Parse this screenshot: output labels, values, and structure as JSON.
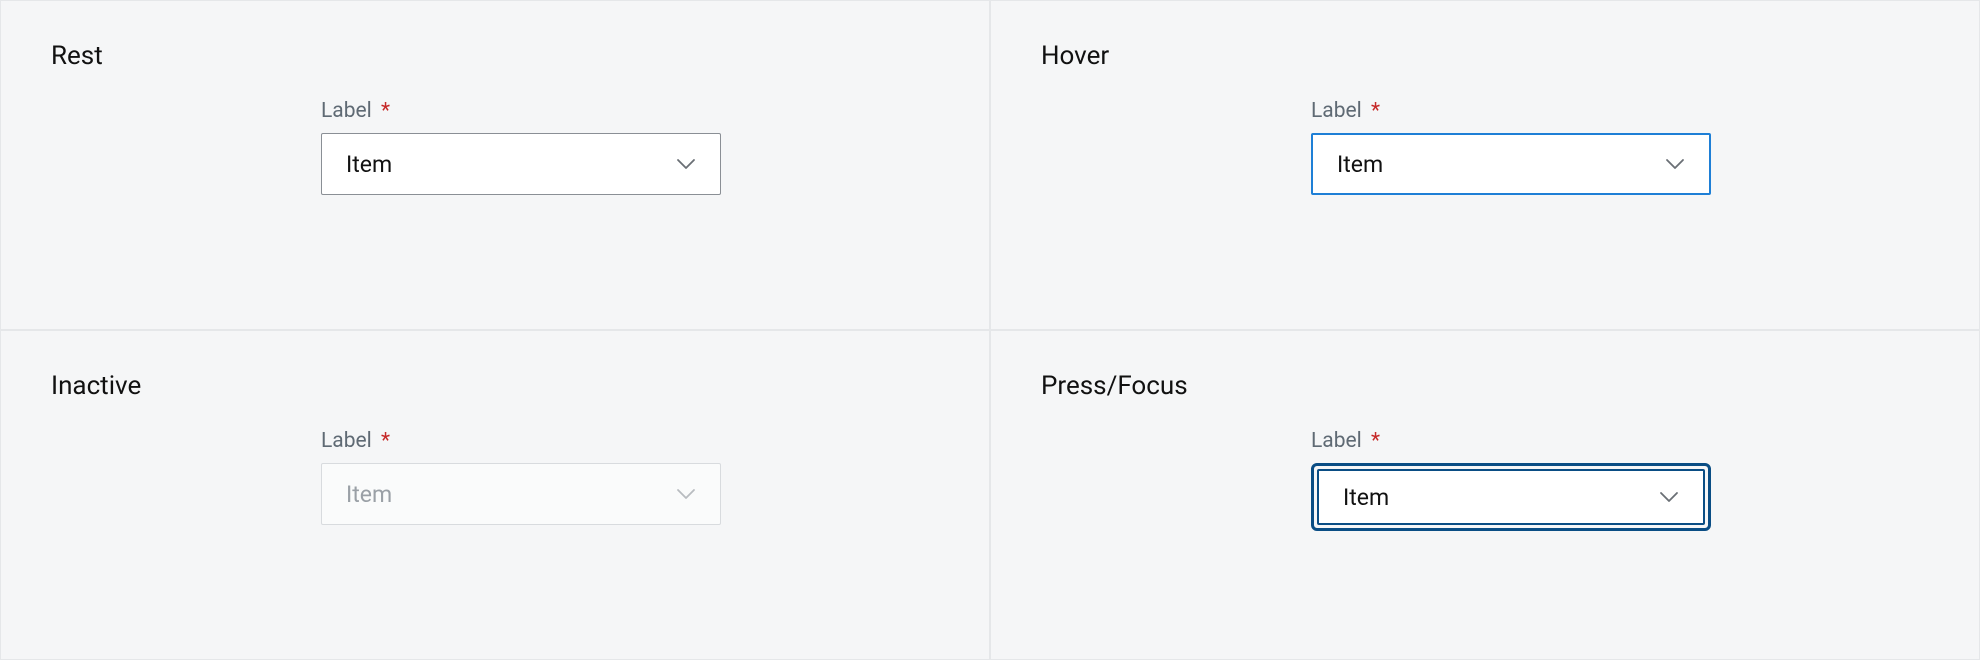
{
  "states": {
    "rest": {
      "title": "Rest",
      "label": "Label",
      "required": "*",
      "value": "Item"
    },
    "hover": {
      "title": "Hover",
      "label": "Label",
      "required": "*",
      "value": "Item"
    },
    "inactive": {
      "title": "Inactive",
      "label": "Label",
      "required": "*",
      "value": "Item"
    },
    "focus": {
      "title": "Press/Focus",
      "label": "Label",
      "required": "*",
      "value": "Item"
    }
  }
}
